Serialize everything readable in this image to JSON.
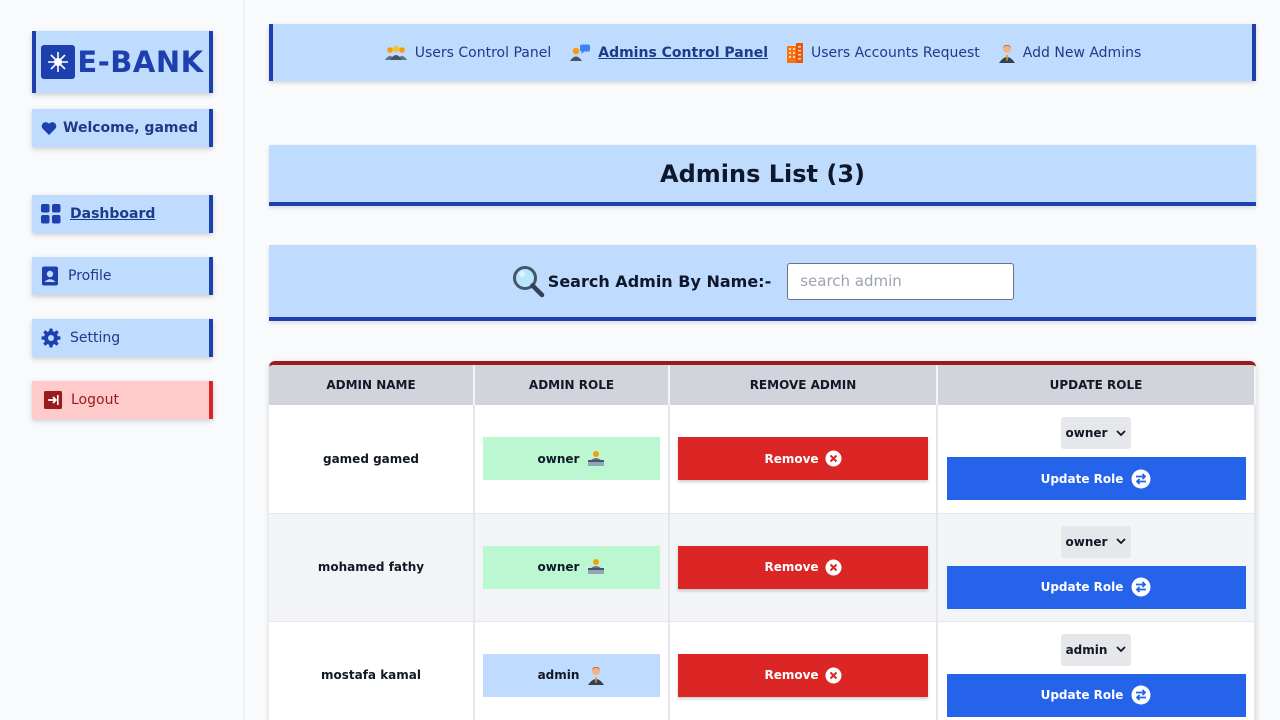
{
  "sidebar": {
    "logo_text": "E-BANK",
    "welcome": "Welcome, gamed",
    "items": [
      {
        "label": "Dashboard",
        "icon": "grid-icon"
      },
      {
        "label": "Profile",
        "icon": "user-card-icon"
      },
      {
        "label": "Setting",
        "icon": "gear-icon"
      },
      {
        "label": "Logout",
        "icon": "logout-icon"
      }
    ]
  },
  "topnav": {
    "items": [
      {
        "label": "Users Control Panel",
        "icon": "users-group-icon"
      },
      {
        "label": "Admins Control Panel",
        "icon": "admin-chat-icon",
        "active": true
      },
      {
        "label": "Users Accounts Request",
        "icon": "building-icon"
      },
      {
        "label": "Add New Admins",
        "icon": "person-icon"
      }
    ]
  },
  "main": {
    "title": "Admins List (3)",
    "search": {
      "label": "Search Admin By Name:-",
      "placeholder": "search admin",
      "value": ""
    }
  },
  "table": {
    "headers": [
      "ADMIN NAME",
      "ADMIN ROLE",
      "REMOVE ADMIN",
      "UPDATE ROLE"
    ],
    "rows": [
      {
        "name": "gamed gamed",
        "role": "owner",
        "remove_label": "Remove",
        "selected_role": "owner",
        "update_label": "Update Role"
      },
      {
        "name": "mohamed fathy",
        "role": "owner",
        "remove_label": "Remove",
        "selected_role": "owner",
        "update_label": "Update Role"
      },
      {
        "name": "mostafa kamal",
        "role": "admin",
        "remove_label": "Remove",
        "selected_role": "admin",
        "update_label": "Update Role"
      }
    ]
  },
  "colors": {
    "primary": "#1e40af",
    "panel": "#bfdbfe",
    "danger": "#dc2626",
    "update": "#2563eb",
    "owner_badge": "#bbf7d0"
  }
}
